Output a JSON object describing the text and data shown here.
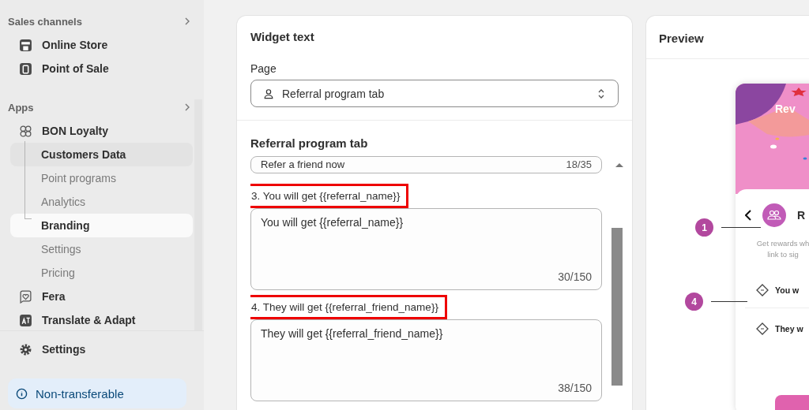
{
  "sidebar": {
    "sections": [
      {
        "title": "Sales channels",
        "items": [
          {
            "label": "Online Store",
            "selected": false
          },
          {
            "label": "Point of Sale",
            "selected": false
          }
        ]
      },
      {
        "title": "Apps",
        "items": [
          {
            "label": "BON Loyalty",
            "selected": false,
            "children": [
              {
                "label": "Customers Data",
                "selected": false,
                "hovered": true
              },
              {
                "label": "Point programs",
                "selected": false,
                "hovered": false
              },
              {
                "label": "Analytics",
                "selected": false,
                "hovered": false
              },
              {
                "label": "Branding",
                "selected": true,
                "hovered": false
              },
              {
                "label": "Settings",
                "selected": false,
                "hovered": false
              },
              {
                "label": "Pricing",
                "selected": false,
                "hovered": false
              }
            ]
          },
          {
            "label": "Fera",
            "selected": false
          },
          {
            "label": "Translate & Adapt",
            "selected": false
          }
        ]
      }
    ],
    "footer": {
      "label": "Settings"
    },
    "badge": "Non-transferable"
  },
  "editor": {
    "title": "Widget text",
    "page_label": "Page",
    "page_value": "Referral program tab",
    "section_title": "Referral program tab",
    "fields": [
      {
        "value": "Refer a friend now",
        "counter": "18/35",
        "highlighted": false
      },
      {
        "label": "3. You will get {{referral_name}}",
        "value": "You will get {{referral_name}}",
        "counter": "30/150",
        "highlighted": true
      },
      {
        "label": "4. They will get {{referral_friend_name}}",
        "value": "They will get {{referral_friend_name}}",
        "counter": "38/150",
        "highlighted": true
      }
    ]
  },
  "preview": {
    "title": "Preview",
    "banner_title": "Rev",
    "card_title": "R",
    "description": "Get rewards wh link to sig",
    "rows": [
      "You w",
      "They w"
    ],
    "callouts": [
      {
        "number": "1"
      },
      {
        "number": "4"
      }
    ]
  }
}
